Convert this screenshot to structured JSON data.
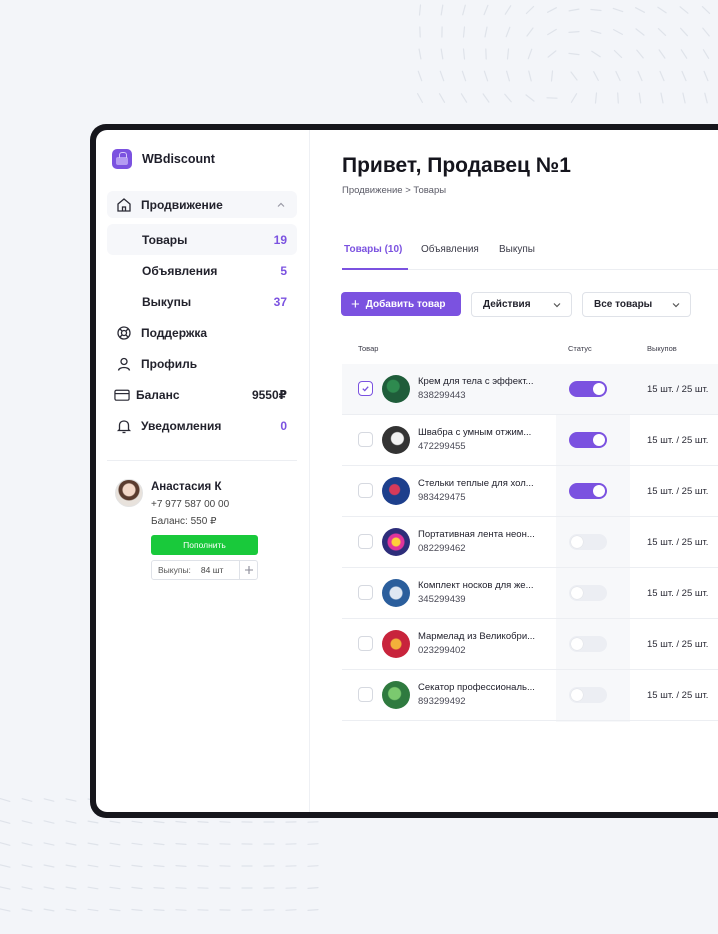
{
  "app": {
    "brand": "WBdiscount"
  },
  "colors": {
    "accent": "#7b52e0",
    "success": "#19c93b",
    "background": "#f3f5f9"
  },
  "sidebar": {
    "group": {
      "label": "Продвижение",
      "icon": "home-icon"
    },
    "sub_items": [
      {
        "label": "Товары",
        "count": "19",
        "active": true
      },
      {
        "label": "Объявления",
        "count": "5"
      },
      {
        "label": "Выкупы",
        "count": "37"
      }
    ],
    "items": [
      {
        "label": "Поддержка",
        "icon": "support-icon",
        "value": ""
      },
      {
        "label": "Профиль",
        "icon": "user-icon",
        "value": ""
      },
      {
        "label": "Баланс",
        "icon": "card-icon",
        "value": "9550₽"
      },
      {
        "label": "Уведомления",
        "icon": "bell-icon",
        "value": "0"
      }
    ]
  },
  "profile": {
    "name": "Анастасия К",
    "phone": "+7 977 587 00 00",
    "balance": "Баланс: 550 ₽",
    "topup_label": "Пополнить",
    "vykupy_label": "Выкупы:",
    "vykupy_value": "84 шт"
  },
  "header": {
    "title": "Привет, Продавец №1",
    "breadcrumb": "Продвижение > Товары"
  },
  "tabs": [
    {
      "label": "Товары (10)",
      "active": true
    },
    {
      "label": "Объявления"
    },
    {
      "label": "Выкупы"
    }
  ],
  "toolbar": {
    "add_label": "Добавить товар",
    "actions_label": "Действия",
    "filter_label": "Все товары"
  },
  "table": {
    "columns": [
      "Товар",
      "Статус",
      "Выкупов"
    ],
    "rows": [
      {
        "name": "Крем для тела с эффект...",
        "sku": "838299443",
        "status": true,
        "checked": true,
        "vykupy": "15 шт. / 25 шт."
      },
      {
        "name": "Швабра с умным отжим...",
        "sku": "472299455",
        "status": true,
        "checked": false,
        "vykupy": "15 шт. / 25 шт."
      },
      {
        "name": "Стельки теплые для хол...",
        "sku": "983429475",
        "status": true,
        "checked": false,
        "vykupy": "15 шт. / 25 шт."
      },
      {
        "name": "Портативная лента неон...",
        "sku": "082299462",
        "status": false,
        "checked": false,
        "vykupy": "15 шт. / 25 шт."
      },
      {
        "name": "Комплект носков для же...",
        "sku": "345299439",
        "status": false,
        "checked": false,
        "vykupy": "15 шт. / 25 шт."
      },
      {
        "name": "Мармелад из Великобри...",
        "sku": "023299402",
        "status": false,
        "checked": false,
        "vykupy": "15 шт. / 25 шт."
      },
      {
        "name": "Секатор профессиональ...",
        "sku": "893299492",
        "status": false,
        "checked": false,
        "vykupy": "15 шт. / 25 шт."
      }
    ]
  }
}
